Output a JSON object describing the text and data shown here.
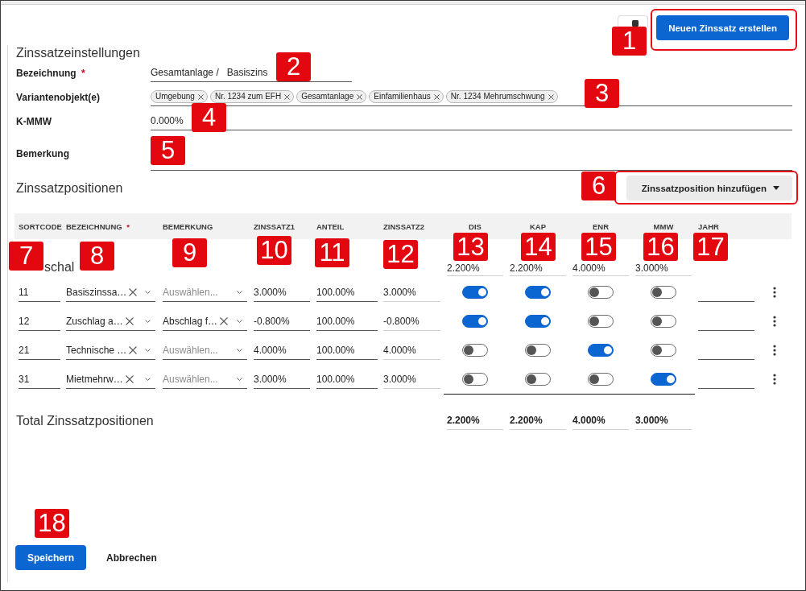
{
  "header": {
    "create_button": {
      "label": "Neuen Zinssatz erstellen",
      "highlighted": true
    }
  },
  "settings": {
    "title": "Zinssatzeinstellungen",
    "fields": [
      {
        "kind": "text",
        "label": "Bezeichnung",
        "required_mark": "*",
        "prefix": "Gesamtanlage /",
        "value": "Basiszins"
      },
      {
        "kind": "chips",
        "label": "Variantenobjekt(e)",
        "chips": [
          "Umgebung",
          "Nr. 1234 zum EFH",
          "Gesamtanlage",
          "Einfamilienhaus",
          "Nr. 1234 Mehrumschwung"
        ]
      },
      {
        "kind": "text",
        "label": "K-MMW",
        "value": "0.000%"
      },
      {
        "kind": "textarea",
        "label": "Bemerkung"
      }
    ]
  },
  "positions": {
    "title": "Zinssatzpositionen",
    "add_button": {
      "label": "Zinssatzposition hinzufügen",
      "highlighted": true
    },
    "columns": [
      {
        "label": "SORTCODE"
      },
      {
        "label": "BEZEICHNUNG",
        "required_mark": "*"
      },
      {
        "label": "BEMERKUNG"
      },
      {
        "label": "ZINSSATZ1"
      },
      {
        "label": "ANTEIL"
      },
      {
        "label": "ZINSSATZ2"
      },
      {
        "label": "DIS"
      },
      {
        "label": "KAP"
      },
      {
        "label": "ENR"
      },
      {
        "label": "MMW"
      },
      {
        "label": "JAHR"
      }
    ],
    "group": {
      "label": "schal",
      "totals": [
        "2.200%",
        "2.200%",
        "4.000%",
        "3.000%"
      ]
    },
    "rows": [
      {
        "sortcode": "11",
        "bezeichnung": {
          "value": "Basiszinssa…"
        },
        "bemerkung": {
          "placeholder": "Auswählen..."
        },
        "zinssatz1": "3.000%",
        "anteil": "100.00%",
        "zinssatz2": "3.000%",
        "toggles": [
          {
            "on": true
          },
          {
            "on": true
          },
          {
            "on": false
          },
          {
            "on": false
          }
        ]
      },
      {
        "sortcode": "12",
        "bezeichnung": {
          "value": "Zuschlag a…"
        },
        "bemerkung": {
          "value": "Abschlag f…"
        },
        "zinssatz1": "-0.800%",
        "anteil": "100.00%",
        "zinssatz2": "-0.800%",
        "toggles": [
          {
            "on": true
          },
          {
            "on": true
          },
          {
            "on": false
          },
          {
            "on": false
          }
        ]
      },
      {
        "sortcode": "21",
        "bezeichnung": {
          "value": "Technische …"
        },
        "bemerkung": {
          "placeholder": "Auswählen..."
        },
        "zinssatz1": "4.000%",
        "anteil": "100.00%",
        "zinssatz2": "4.000%",
        "toggles": [
          {
            "on": false
          },
          {
            "on": false
          },
          {
            "on": true
          },
          {
            "on": false
          }
        ]
      },
      {
        "sortcode": "31",
        "bezeichnung": {
          "value": "Mietmehrw…"
        },
        "bemerkung": {
          "placeholder": "Auswählen..."
        },
        "zinssatz1": "3.000%",
        "anteil": "100.00%",
        "zinssatz2": "3.000%",
        "toggles": [
          {
            "on": false
          },
          {
            "on": false
          },
          {
            "on": false
          },
          {
            "on": true
          }
        ]
      }
    ],
    "total": {
      "label": "Total Zinssatzpositionen",
      "values": [
        "2.200%",
        "2.200%",
        "4.000%",
        "3.000%"
      ]
    }
  },
  "footer": {
    "save_button": "Speichern",
    "cancel_button": "Abbrechen"
  },
  "annotations": [
    "1",
    "2",
    "3",
    "4",
    "5",
    "6",
    "7",
    "8",
    "9",
    "10",
    "11",
    "12",
    "13",
    "14",
    "15",
    "16",
    "17",
    "18"
  ]
}
